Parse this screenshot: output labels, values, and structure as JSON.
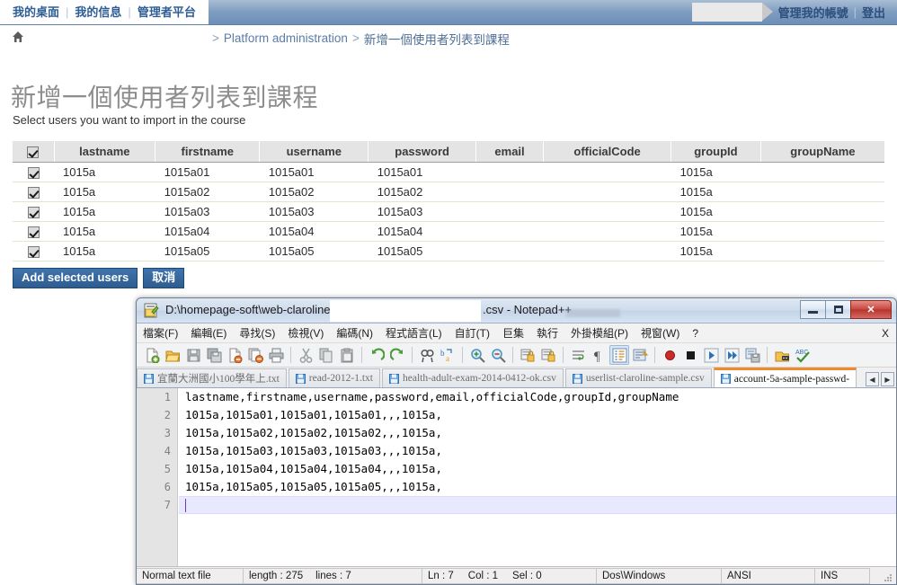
{
  "web": {
    "nav_left": [
      {
        "label": "我的桌面",
        "name": "nav-my-desktop"
      },
      {
        "label": "我的信息",
        "name": "nav-my-info"
      },
      {
        "label": "管理者平台",
        "name": "nav-admin-platform"
      }
    ],
    "nav_right": [
      {
        "label": "管理我的帳號",
        "name": "nav-manage-account"
      },
      {
        "label": "登出",
        "name": "nav-logout"
      }
    ],
    "breadcrumb": {
      "home_icon": "home-icon",
      "gt": ">",
      "items": [
        {
          "label": "Platform administration",
          "name": "breadcrumb-platform-administration"
        },
        {
          "label": "新增一個使用者列表到課程",
          "name": "breadcrumb-current-page"
        }
      ]
    },
    "title": "新增一個使用者列表到課程",
    "subtitle": "Select users you want to import in the course",
    "table": {
      "headers": [
        "lastname",
        "firstname",
        "username",
        "password",
        "email",
        "officialCode",
        "groupId",
        "groupName"
      ],
      "header_checkbox_checked": true,
      "rows": [
        {
          "checked": true,
          "lastname": "1015a",
          "firstname": "1015a01",
          "username": "1015a01",
          "password": "1015a01",
          "email": "",
          "officialCode": "",
          "groupId": "1015a",
          "groupName": ""
        },
        {
          "checked": true,
          "lastname": "1015a",
          "firstname": "1015a02",
          "username": "1015a02",
          "password": "1015a02",
          "email": "",
          "officialCode": "",
          "groupId": "1015a",
          "groupName": ""
        },
        {
          "checked": true,
          "lastname": "1015a",
          "firstname": "1015a03",
          "username": "1015a03",
          "password": "1015a03",
          "email": "",
          "officialCode": "",
          "groupId": "1015a",
          "groupName": ""
        },
        {
          "checked": true,
          "lastname": "1015a",
          "firstname": "1015a04",
          "username": "1015a04",
          "password": "1015a04",
          "email": "",
          "officialCode": "",
          "groupId": "1015a",
          "groupName": ""
        },
        {
          "checked": true,
          "lastname": "1015a",
          "firstname": "1015a05",
          "username": "1015a05",
          "password": "1015a05",
          "email": "",
          "officialCode": "",
          "groupId": "1015a",
          "groupName": ""
        }
      ]
    },
    "buttons": {
      "submit": "Add selected users",
      "cancel": "取消"
    },
    "colors": {
      "header_gradient_top": "#a8bdd4",
      "header_gradient_bottom": "#6e8fb6",
      "link": "#2e5e95",
      "button": "#2d5c90",
      "title_gray": "#8d8d8d"
    }
  },
  "notepad": {
    "title_path": "D:\\homepage-soft\\web-claroline\\",
    "title_suffix": ".csv - Notepad++",
    "window_buttons": {
      "minimize": "minimize-icon",
      "maximize": "maximize-icon",
      "close": "✕"
    },
    "menu": [
      "檔案(F)",
      "編輯(E)",
      "尋找(S)",
      "檢視(V)",
      "編碼(N)",
      "程式語言(L)",
      "自訂(T)",
      "巨集",
      "執行",
      "外掛模組(P)",
      "視窗(W)",
      "?"
    ],
    "menu_close": "X",
    "toolbar_icons": [
      "new-file-icon",
      "open-file-icon",
      "save-icon",
      "save-all-icon",
      "close-file-icon",
      "close-all-icon",
      "print-icon",
      "cut-icon",
      "copy-icon",
      "paste-icon",
      "undo-icon",
      "redo-icon",
      "find-icon",
      "replace-icon",
      "zoom-in-icon",
      "zoom-out-icon",
      "sync-vertical-scroll-icon",
      "sync-horizontal-scroll-icon",
      "word-wrap-icon",
      "show-all-characters-icon",
      "indent-guide-icon",
      "user-defined-language-icon",
      "record-macro-icon",
      "stop-recording-icon",
      "play-macro-icon",
      "run-macro-multiple-icon",
      "save-macro-icon",
      "run-icon",
      "spell-check-icon"
    ],
    "tabs": [
      {
        "label": "宜蘭大洲國小100學年上.txt",
        "active": false
      },
      {
        "label": "read-2012-1.txt",
        "active": false
      },
      {
        "label": "health-adult-exam-2014-0412-ok.csv",
        "active": false
      },
      {
        "label": "userlist-claroline-sample.csv",
        "active": false
      },
      {
        "label": "account-5a-sample-passwd-",
        "active": true
      }
    ],
    "tab_scroll_left": "◀",
    "tab_scroll_right": "▶",
    "editor": {
      "line_numbers": [
        1,
        2,
        3,
        4,
        5,
        6,
        7
      ],
      "lines": [
        "lastname,firstname,username,password,email,officialCode,groupId,groupName",
        "1015a,1015a01,1015a01,1015a01,,,1015a,",
        "1015a,1015a02,1015a02,1015a02,,,1015a,",
        "1015a,1015a03,1015a03,1015a03,,,1015a,",
        "1015a,1015a04,1015a04,1015a04,,,1015a,",
        "1015a,1015a05,1015a05,1015a05,,,1015a,",
        ""
      ],
      "caret_line": 7
    },
    "status": {
      "file_type": "Normal text file",
      "length_label": "length : 275",
      "lines_label": "lines : 7",
      "ln": "Ln : 7",
      "col": "Col : 1",
      "sel": "Sel : 0",
      "eol": "Dos\\Windows",
      "encoding": "ANSI",
      "insert_mode": "INS"
    },
    "colors": {
      "active_tab_accent": "#ef8b2c",
      "caret_line_bg": "#e8e8ff",
      "titlebar": "#cfdced",
      "close_button": "#c6453e"
    }
  }
}
